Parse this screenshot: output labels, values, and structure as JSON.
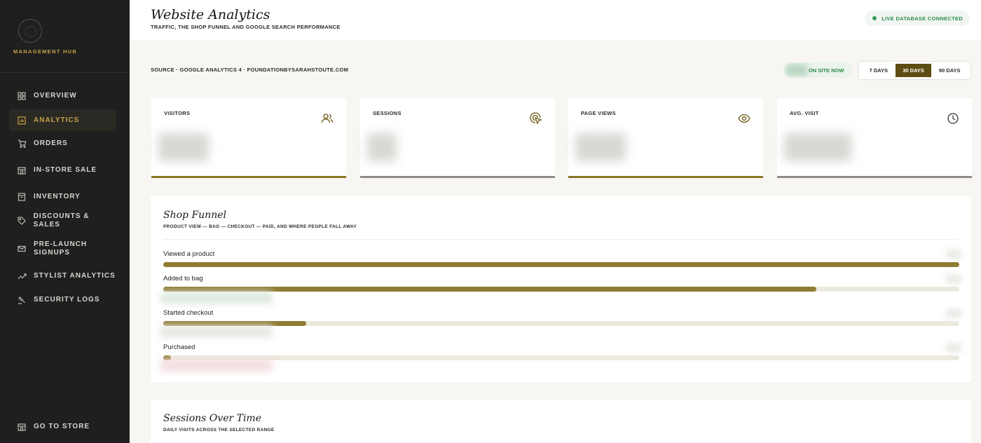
{
  "sidebar": {
    "brand": "MANAGEMENT HUB",
    "items": [
      {
        "label": "OVERVIEW",
        "icon": "grid-icon"
      },
      {
        "label": "ANALYTICS",
        "icon": "chart-box-icon",
        "active": true
      },
      {
        "label": "ORDERS",
        "icon": "cart-icon"
      },
      {
        "label": "IN-STORE SALE",
        "icon": "storefront-icon"
      },
      {
        "label": "INVENTORY",
        "icon": "box-icon"
      },
      {
        "label": "DISCOUNTS & SALES",
        "icon": "tag-icon"
      },
      {
        "label": "PRE-LAUNCH\nSIGNUPS",
        "icon": "mail-icon"
      },
      {
        "label": "STYLIST ANALYTICS",
        "icon": "trend-icon"
      },
      {
        "label": "SECURITY LOGS",
        "icon": "gavel-icon"
      }
    ],
    "footer": {
      "label": "GO TO STORE",
      "icon": "storefront-icon"
    }
  },
  "header": {
    "title": "Website Analytics",
    "subtitle": "TRAFFIC, THE SHOP FUNNEL AND GOOGLE SEARCH PERFORMANCE",
    "status": "LIVE DATABASE CONNECTED",
    "status_color": "#2f8a4c"
  },
  "toolbar": {
    "source": "SOURCE · GOOGLE ANALYTICS 4 · FOUNDATIONBYSARAHSTOUTE.COM",
    "on_site": "ON SITE NOW",
    "ranges": [
      "7 DAYS",
      "30 DAYS",
      "90 DAYS"
    ],
    "selected_range": "30 DAYS"
  },
  "kpis": [
    {
      "label": "VISITORS",
      "icon": "users-icon"
    },
    {
      "label": "SESSIONS",
      "icon": "cursor-click-icon"
    },
    {
      "label": "PAGE VIEWS",
      "icon": "eye-icon"
    },
    {
      "label": "AVG. VISIT",
      "icon": "clock-icon"
    }
  ],
  "funnel": {
    "title": "Shop Funnel",
    "subtitle": "PRODUCT VIEW — BAG — CHECKOUT — PAID, AND WHERE PEOPLE FALL AWAY",
    "steps": [
      {
        "label": "Viewed a product",
        "fraction": 1.0
      },
      {
        "label": "Added to bag",
        "fraction": 0.82
      },
      {
        "label": "Started checkout",
        "fraction": 0.18
      },
      {
        "label": "Purchased",
        "fraction": 0.01
      }
    ]
  },
  "sessions_card": {
    "title": "Sessions Over Time",
    "subtitle": "DAILY VISITS ACROSS THE SELECTED RANGE"
  },
  "colors": {
    "accent": "#c8a24a",
    "bar": "#8f7c33",
    "sidebar": "#1f1f1f"
  }
}
